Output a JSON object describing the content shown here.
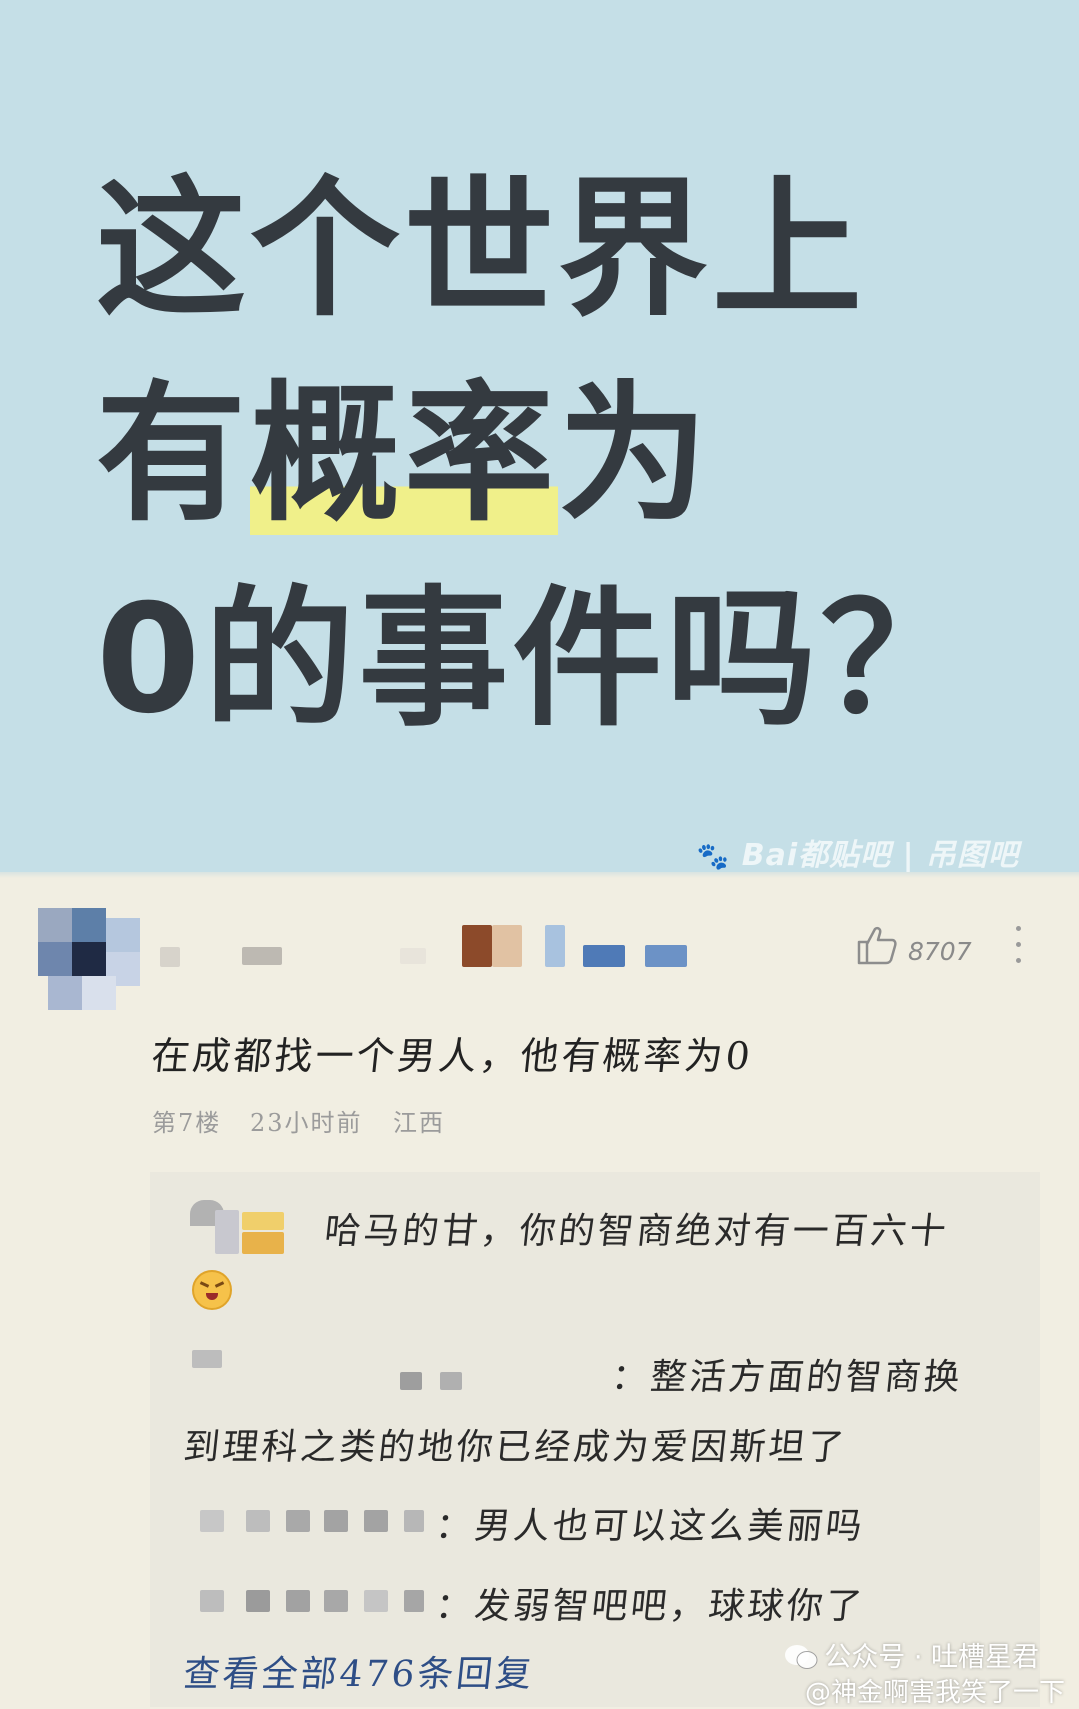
{
  "poster": {
    "line1": "这个世界上",
    "line2_prefix": "有",
    "line2_highlight": "概率",
    "line2_suffix": "为",
    "line3": "0的事件吗？",
    "source_watermark": "Bai都贴吧 | 吊图吧"
  },
  "comment": {
    "like_count": "8707",
    "text": "在成都找一个男人，他有概率为0",
    "floor": "第7楼",
    "time": "23小时前",
    "location": "江西"
  },
  "replies": [
    {
      "text": "哈马的甘，你的智商绝对有一百六十"
    },
    {
      "text": "：整活方面的智商换"
    },
    {
      "text": "到理科之类的地你已经成为爱因斯坦了"
    },
    {
      "text": "：男人也可以这么美丽吗"
    },
    {
      "text": "：发弱智吧吧，球球你了"
    }
  ],
  "view_all": "查看全部476条回复",
  "footer_watermark": {
    "line1": "公众号 · 吐槽星君",
    "line2": "@神金啊害我笑了一下"
  },
  "colors": {
    "poster_bg": "#c5dfe7",
    "highlight": "#f0f08a",
    "page_bg": "#f1eee2",
    "link": "#2e4e86"
  },
  "icons": [
    "thumbs-up-icon",
    "more-vertical-icon",
    "paw-icon",
    "laughing-emoji-icon",
    "wechat-icon"
  ]
}
